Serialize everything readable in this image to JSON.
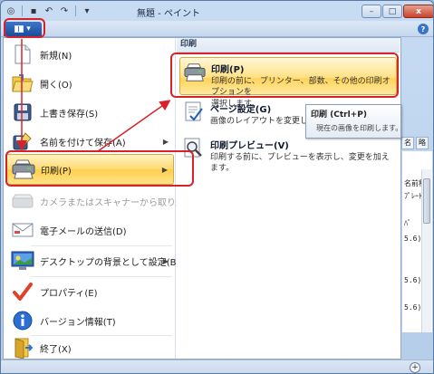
{
  "window": {
    "title": "無題 - ペイント",
    "controls": {
      "minimize": "–",
      "maximize": "□",
      "close": "x"
    },
    "help": "?"
  },
  "qat": {
    "icons": [
      "paint-icon",
      "save-icon",
      "undo-icon",
      "redo-icon",
      "dropdown-icon"
    ],
    "glyphs": [
      "◎",
      "▪",
      "↶",
      "↷",
      "▾"
    ]
  },
  "app_button": {
    "arrow": "▾"
  },
  "left_menu": {
    "items": [
      {
        "label": "新規(N)",
        "icon": "new-file-icon",
        "enabled": true,
        "submenu": false
      },
      {
        "label": "開く(O)",
        "icon": "open-folder-icon",
        "enabled": true,
        "submenu": false
      },
      {
        "label": "上書き保存(S)",
        "icon": "save-icon",
        "enabled": true,
        "submenu": false
      },
      {
        "label": "名前を付けて保存(A)",
        "icon": "save-as-icon",
        "enabled": true,
        "submenu": true
      },
      {
        "label": "印刷(P)",
        "icon": "printer-icon",
        "enabled": true,
        "submenu": true,
        "active": true
      },
      {
        "label": "カメラまたはスキャナーから取り込み(M)",
        "icon": "scanner-icon",
        "enabled": false,
        "submenu": false
      },
      {
        "label": "電子メールの送信(D)",
        "icon": "email-icon",
        "enabled": true,
        "submenu": false
      },
      {
        "label": "デスクトップの背景として設定(B)",
        "icon": "desktop-icon",
        "enabled": true,
        "submenu": true
      },
      {
        "label": "プロパティ(E)",
        "icon": "checkmark-icon",
        "enabled": true,
        "submenu": false
      },
      {
        "label": "バージョン情報(T)",
        "icon": "info-icon",
        "enabled": true,
        "submenu": false
      },
      {
        "label": "終了(X)",
        "icon": "exit-icon",
        "enabled": true,
        "submenu": false
      }
    ],
    "arrow": "▶"
  },
  "right_pane": {
    "header": "印刷",
    "items": [
      {
        "title": "印刷(P)",
        "desc_line1": "印刷の前に、プリンター、部数、その他の印刷オプションを",
        "desc_line2": "選択します。",
        "icon": "printer-icon",
        "active": true
      },
      {
        "title": "ページ設定(G)",
        "desc_line1": "画像のレイアウトを変更します。",
        "desc_line2": "",
        "icon": "page-setup-icon",
        "active": false
      },
      {
        "title": "印刷プレビュー(V)",
        "desc_line1": "印刷する前に、プレビューを表示し、変更を加えます。",
        "desc_line2": "",
        "icon": "print-preview-icon",
        "active": false
      }
    ]
  },
  "tooltip": {
    "title": "印刷 (Ctrl+P)",
    "body": "現在の画像を印刷します。"
  },
  "background_panel": {
    "tabs": [
      "名",
      "略"
    ],
    "cells": [
      "名前称",
      "ﾌﾟﾚｰﾄ",
      "ﾊﾟ",
      "5.6)",
      "5.6)",
      "5.6)"
    ]
  },
  "statusbar": {
    "zoom_glyph": "+"
  },
  "colors": {
    "accent": "#1b4c99",
    "highlight": "#ffd970",
    "annotation": "#d8222a"
  }
}
